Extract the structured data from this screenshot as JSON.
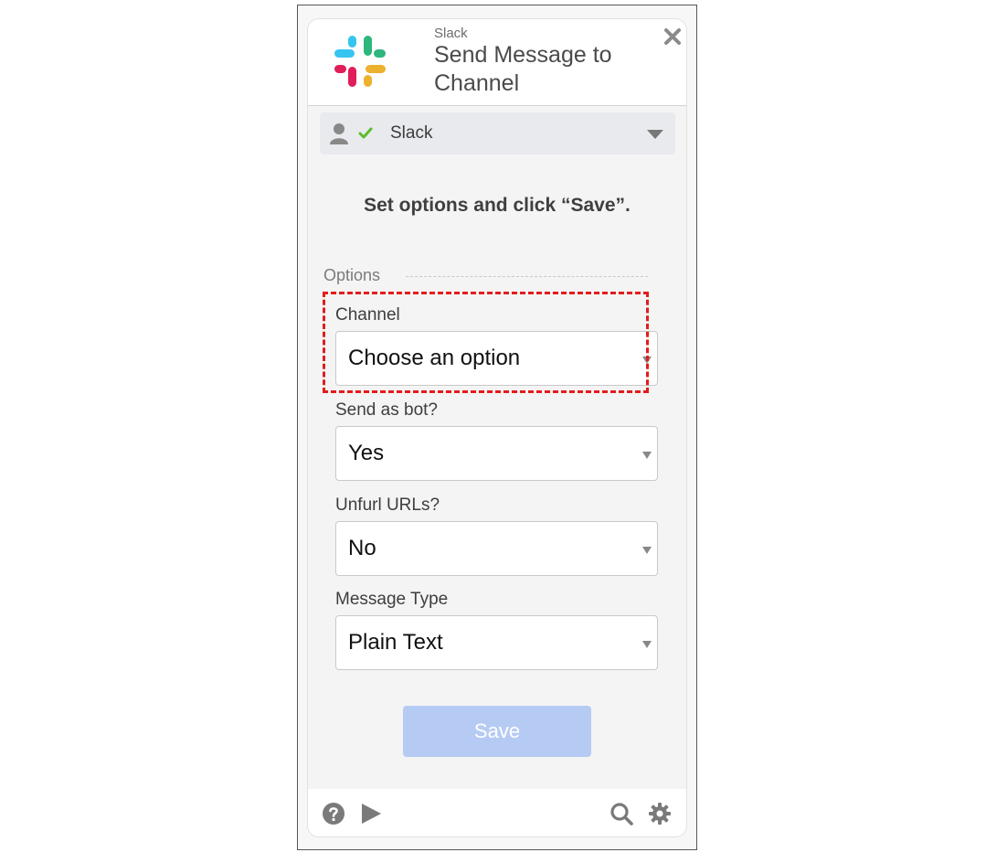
{
  "header": {
    "app_name": "Slack",
    "title": "Send Message to Channel",
    "logo": "slack-logo",
    "close_icon": "close-icon"
  },
  "account": {
    "label": "Slack",
    "connected": true,
    "icons": [
      "user-icon",
      "check-icon",
      "caret-down-icon"
    ]
  },
  "instruction": "Set options and click “Save”.",
  "options": {
    "section_label": "Options",
    "fields": [
      {
        "label": "Channel",
        "value": "Choose an option",
        "highlighted": true
      },
      {
        "label": "Send as bot?",
        "value": "Yes"
      },
      {
        "label": "Unfurl URLs?",
        "value": "No"
      },
      {
        "label": "Message Type",
        "value": "Plain Text"
      }
    ]
  },
  "save_label": "Save",
  "footer": {
    "icons": [
      "help-icon",
      "play-icon",
      "search-icon",
      "gear-icon"
    ]
  },
  "colors": {
    "save_button": "#b6cbf3",
    "highlight_border": "#e41c1c",
    "check": "#5bbd2b",
    "slack_blue": "#36c5f0",
    "slack_green": "#2eb67d",
    "slack_red": "#e01e5a",
    "slack_yellow": "#ecb22e"
  }
}
